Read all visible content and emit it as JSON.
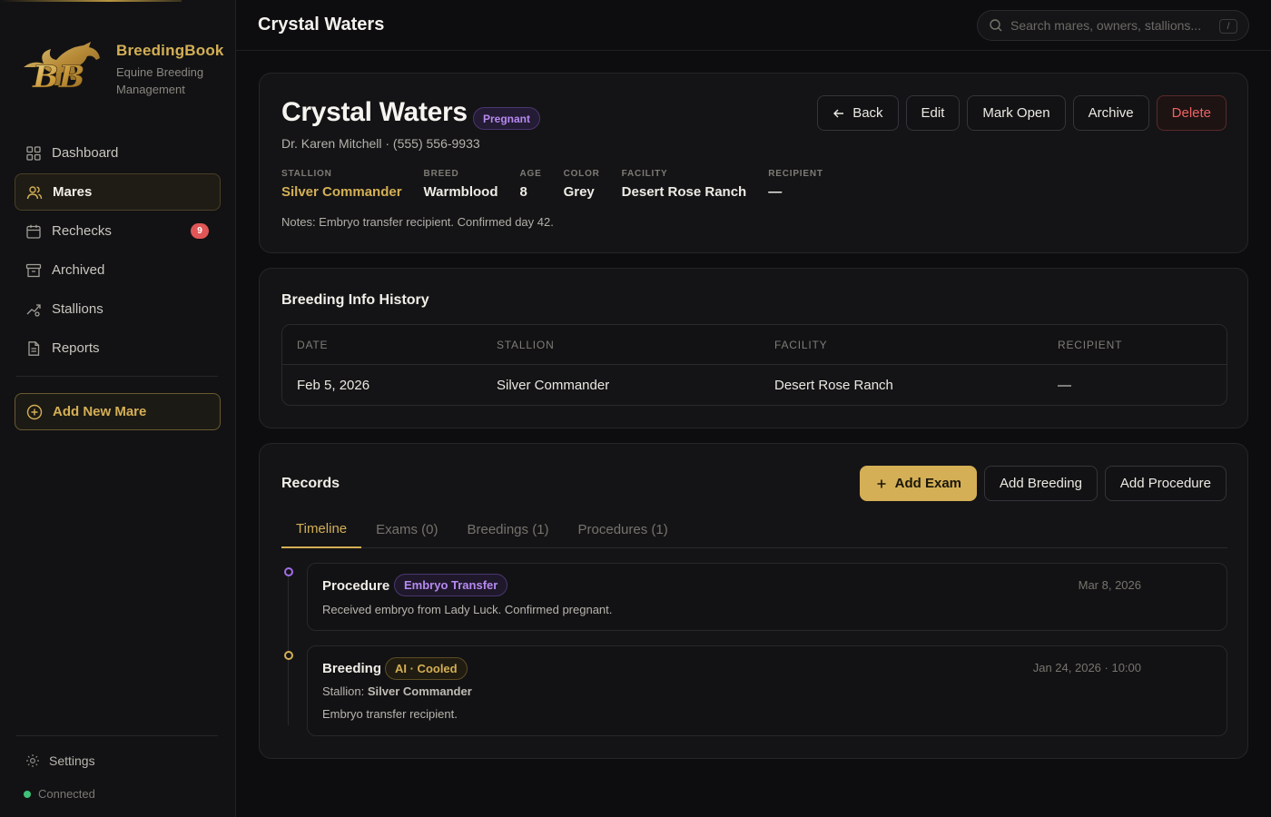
{
  "brand": {
    "name": "BreedingBook",
    "subtitle": "Equine Breeding Management"
  },
  "sidebar": {
    "items": [
      {
        "label": "Dashboard",
        "icon": "grid-icon"
      },
      {
        "label": "Mares",
        "icon": "users-icon",
        "active": true
      },
      {
        "label": "Rechecks",
        "icon": "calendar-icon",
        "badge": "9"
      },
      {
        "label": "Archived",
        "icon": "archive-icon"
      },
      {
        "label": "Stallions",
        "icon": "stallion-icon"
      },
      {
        "label": "Reports",
        "icon": "document-icon"
      }
    ],
    "add_button": "Add New Mare",
    "settings": "Settings",
    "status": "Connected"
  },
  "header": {
    "title": "Crystal Waters",
    "search_placeholder": "Search mares, owners, stallions...",
    "search_shortcut": "/"
  },
  "mare": {
    "name": "Crystal Waters",
    "status": "Pregnant",
    "owner_line": "Dr. Karen Mitchell · (555) 556-9933",
    "facts": {
      "stallion_label": "STALLION",
      "stallion": "Silver Commander",
      "breed_label": "BREED",
      "breed": "Warmblood",
      "age_label": "AGE",
      "age": "8",
      "color_label": "COLOR",
      "color": "Grey",
      "facility_label": "FACILITY",
      "facility": "Desert Rose Ranch",
      "recipient_label": "RECIPIENT",
      "recipient": "—"
    },
    "notes": "Notes: Embryo transfer recipient. Confirmed day 42.",
    "actions": {
      "back": "Back",
      "edit": "Edit",
      "mark_open": "Mark Open",
      "archive": "Archive",
      "delete": "Delete"
    }
  },
  "history": {
    "title": "Breeding Info History",
    "columns": {
      "date": "DATE",
      "stallion": "STALLION",
      "facility": "FACILITY",
      "recipient": "RECIPIENT"
    },
    "rows": [
      {
        "date": "Feb 5, 2026",
        "stallion": "Silver Commander",
        "facility": "Desert Rose Ranch",
        "recipient": "—"
      }
    ]
  },
  "records": {
    "title": "Records",
    "actions": {
      "add_exam": "Add Exam",
      "add_breeding": "Add Breeding",
      "add_procedure": "Add Procedure"
    },
    "tabs": [
      "Timeline",
      "Exams (0)",
      "Breedings (1)",
      "Procedures (1)"
    ],
    "events": [
      {
        "title": "Procedure",
        "tag": "Embryo Transfer",
        "date": "Mar 8, 2026",
        "text": "Received embryo from Lady Luck. Confirmed pregnant."
      },
      {
        "title": "Breeding",
        "tag": "AI · Cooled",
        "date": "Jan 24, 2026 · 10:00",
        "stallion_prefix": "Stallion:",
        "stallion": "Silver Commander",
        "text": "Embryo transfer recipient."
      }
    ]
  },
  "colors": {
    "accent": "#d4af55",
    "pregnant": "#b68af0",
    "danger": "#ee6262",
    "connected": "#3ec27a"
  }
}
